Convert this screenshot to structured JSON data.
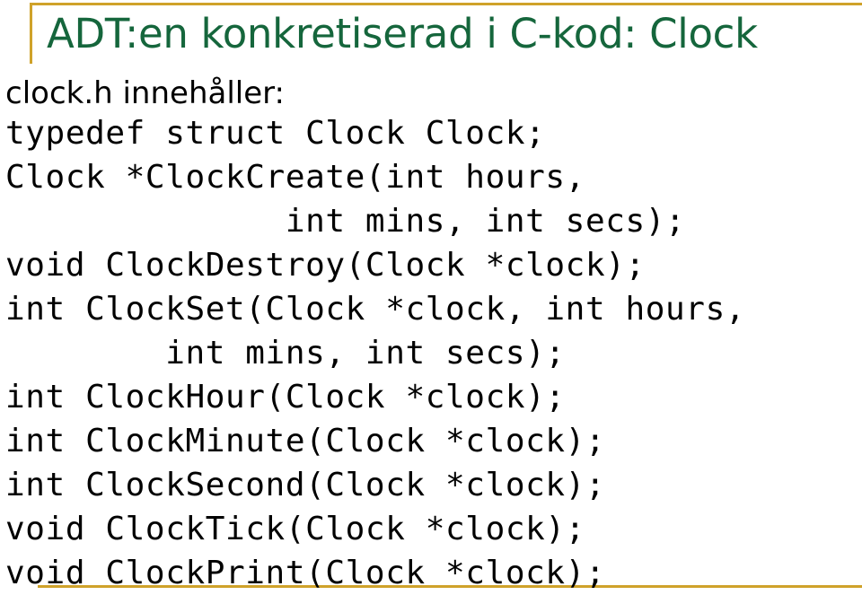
{
  "slide": {
    "title": "ADT:en konkretiserad i C-kod: Clock",
    "title_color": "#15663C",
    "accent_rule_color": "#CFA22A",
    "background_color": "#FFFFFF",
    "body_text_color": "#000000",
    "intro": "clock.h innehåller:",
    "code_lines": [
      {
        "text": "typedef struct Clock Clock;",
        "indent": 0
      },
      {
        "text": "Clock *ClockCreate(int hours,",
        "indent": 0
      },
      {
        "text": "              int mins, int secs);",
        "indent": 0
      },
      {
        "text": "void ClockDestroy(Clock *clock);",
        "indent": 0
      },
      {
        "text": "int ClockSet(Clock *clock, int hours,",
        "indent": 0
      },
      {
        "text": "        int mins, int secs);",
        "indent": 0
      },
      {
        "text": "int ClockHour(Clock *clock);",
        "indent": 0
      },
      {
        "text": "int ClockMinute(Clock *clock);",
        "indent": 0
      },
      {
        "text": "int ClockSecond(Clock *clock);",
        "indent": 0
      },
      {
        "text": "void ClockTick(Clock *clock);",
        "indent": 0
      },
      {
        "text": "void ClockPrint(Clock *clock);",
        "indent": 0
      }
    ]
  }
}
